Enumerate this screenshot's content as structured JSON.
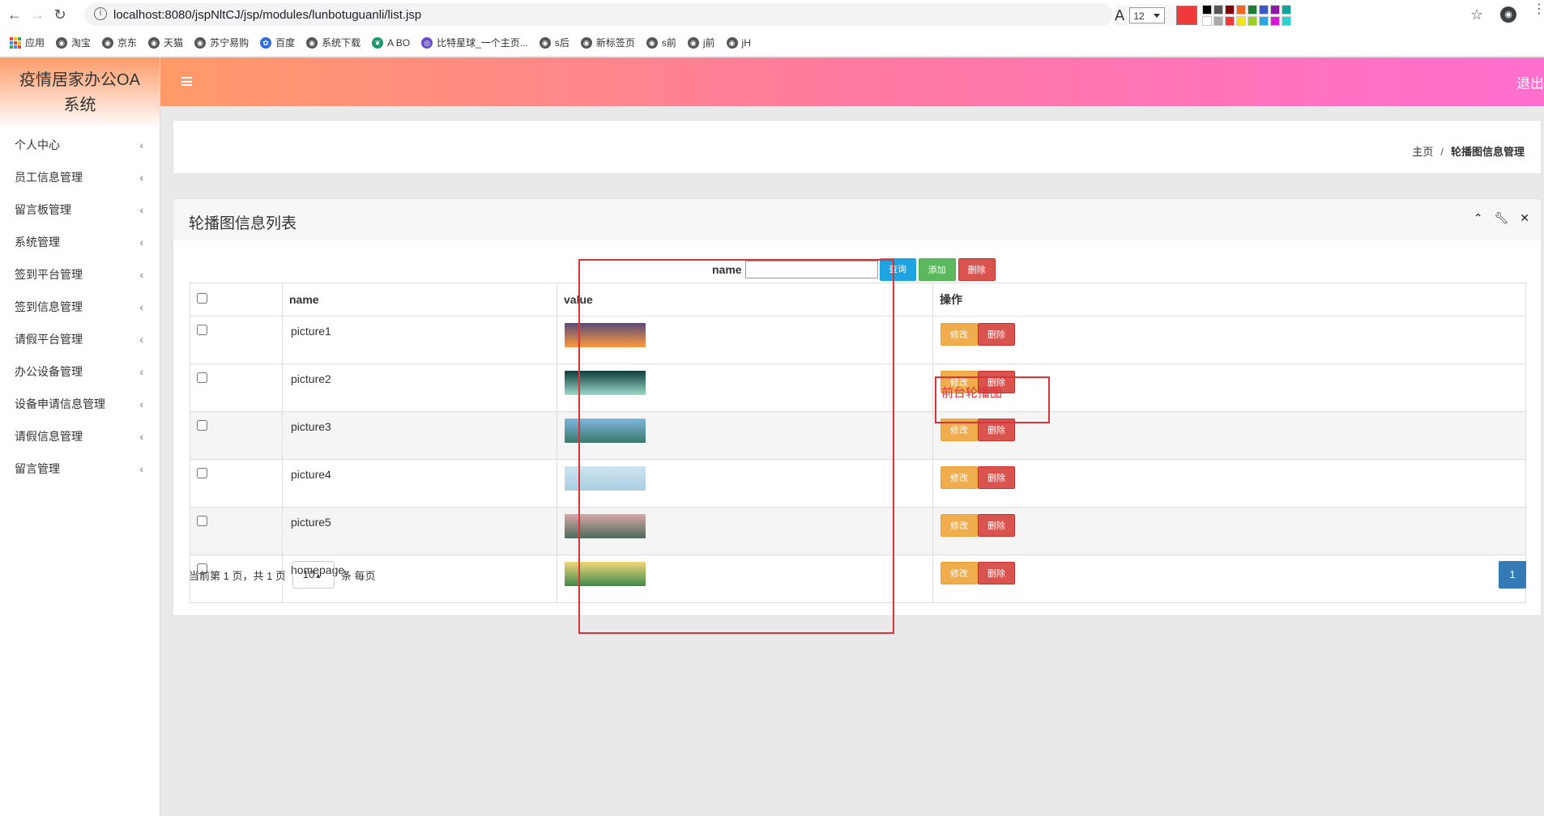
{
  "browser": {
    "url": "localhost:8080/jspNltCJ/jsp/modules/lunbotuguanli/list.jsp",
    "font_size": "12",
    "current_color": "#f03a3a",
    "palette": [
      "#000000",
      "#555555",
      "#7f0000",
      "#f26522",
      "#1e7b34",
      "#3d59c9",
      "#8a1aa6",
      "#10a39b",
      "#ffffff",
      "#aaaaaa",
      "#f03a3a",
      "#f5e31a",
      "#9ccc2a",
      "#2aa6e0",
      "#d61ad6",
      "#2ad2d2"
    ],
    "bookmarks": [
      {
        "label": "应用",
        "icon": "apps-icon"
      },
      {
        "label": "淘宝",
        "icon": "globe-icon"
      },
      {
        "label": "京东",
        "icon": "globe-icon"
      },
      {
        "label": "天猫",
        "icon": "globe-icon"
      },
      {
        "label": "苏宁易购",
        "icon": "globe-icon"
      },
      {
        "label": "百度",
        "icon": "paw-icon"
      },
      {
        "label": "系统下载",
        "icon": "globe-icon"
      },
      {
        "label": "A BO",
        "icon": "leaf-icon"
      },
      {
        "label": "比特星球_一个主页...",
        "icon": "planet-icon"
      },
      {
        "label": "s后",
        "icon": "globe-icon"
      },
      {
        "label": "新标签页",
        "icon": "globe-icon"
      },
      {
        "label": "s前",
        "icon": "globe-icon"
      },
      {
        "label": "j前",
        "icon": "globe-icon"
      },
      {
        "label": "jH",
        "icon": "globe-icon"
      }
    ]
  },
  "app": {
    "title": "疫情居家办公OA系统",
    "logout": "退出",
    "menu": [
      "个人中心",
      "员工信息管理",
      "留言板管理",
      "系统管理",
      "签到平台管理",
      "签到信息管理",
      "请假平台管理",
      "办公设备管理",
      "设备申请信息管理",
      "请假信息管理",
      "留言管理"
    ]
  },
  "breadcrumb": {
    "home": "主页",
    "separator": "/",
    "current": "轮播图信息管理"
  },
  "panel": {
    "title": "轮播图信息列表"
  },
  "search": {
    "label": "name",
    "value": "",
    "query_label": "查询",
    "add_label": "添加",
    "delete_label": "删除"
  },
  "table": {
    "headers": {
      "name": "name",
      "value": "value",
      "ops": "操作"
    },
    "edit_label": "修改",
    "delete_label": "删除",
    "rows": [
      {
        "name": "picture1",
        "thumb": [
          "#5a4a7a",
          "#ff9a3c"
        ]
      },
      {
        "name": "picture2",
        "thumb": [
          "#0f3b3a",
          "#9ad9c8"
        ]
      },
      {
        "name": "picture3",
        "thumb": [
          "#7fb6e0",
          "#3a7a6a"
        ]
      },
      {
        "name": "picture4",
        "thumb": [
          "#cde3ef",
          "#a9cfe2"
        ]
      },
      {
        "name": "picture5",
        "thumb": [
          "#d8a8a8",
          "#4b6b5a"
        ]
      },
      {
        "name": "homepage",
        "thumb": [
          "#f2d77a",
          "#3e8a4a"
        ]
      }
    ]
  },
  "pager": {
    "info": "当前第 1 页，共 1 页",
    "page_size": "10",
    "per_page_text": "条 每页",
    "current_page": "1"
  },
  "annotation": {
    "text": "前台轮播图"
  }
}
